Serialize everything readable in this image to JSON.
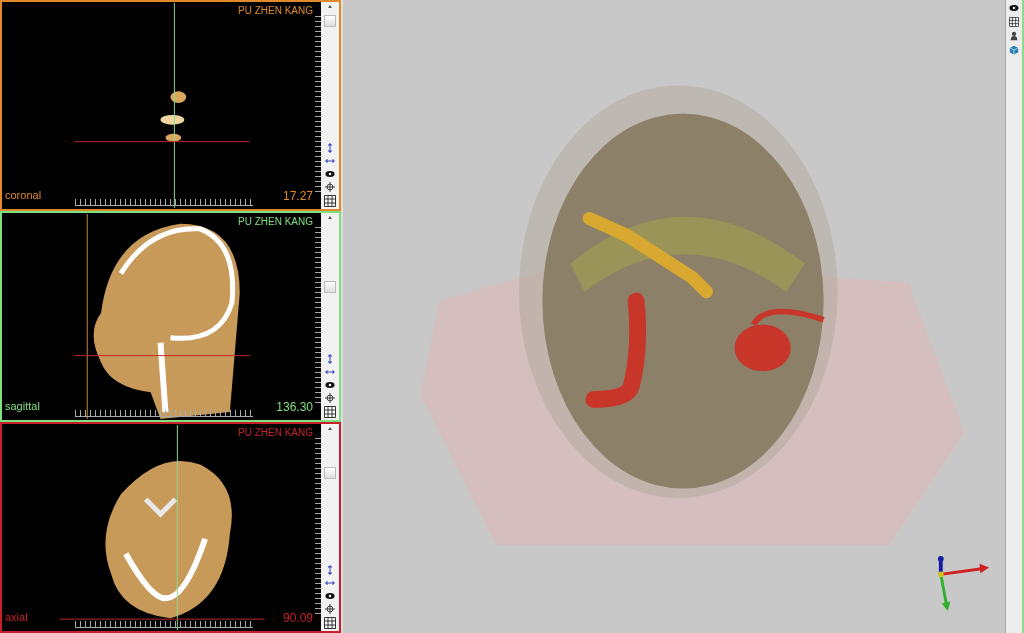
{
  "viewports": [
    {
      "kind": "coronal",
      "patient": "PU ZHEN KANG",
      "label": "coronal",
      "value": "17.27",
      "color": "#e08a2c"
    },
    {
      "kind": "sagittal",
      "patient": "PU ZHEN KANG",
      "label": "sagittal",
      "value": "136.30",
      "color": "#7ee07e"
    },
    {
      "kind": "axial",
      "patient": "PU ZHEN KANG",
      "label": "axial",
      "value": "90.09",
      "color": "#c8202a"
    }
  ]
}
